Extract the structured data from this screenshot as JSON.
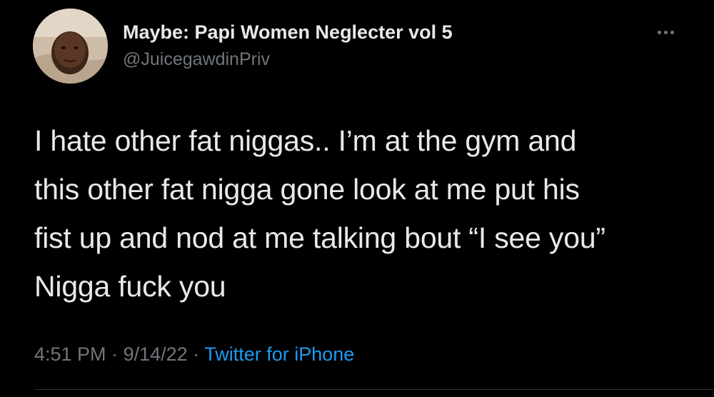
{
  "author": {
    "display_name": "Maybe: Papi Women Neglecter vol 5",
    "handle": "@JuicegawdinPriv"
  },
  "more_icon": "more-horizontal-icon",
  "tweet": {
    "lines": [
      "I hate other fat niggas.. I’m at the gym and",
      "this other fat nigga gone look at me put his",
      "fist up and nod at me talking bout “I see you”",
      "Nigga fuck you"
    ]
  },
  "meta": {
    "time": "4:51 PM",
    "separator": "·",
    "date": "9/14/22",
    "source": "Twitter for iPhone"
  },
  "colors": {
    "background": "#000000",
    "primary_text": "#e7e9ea",
    "secondary_text": "#71767b",
    "link": "#1d9bf0"
  }
}
